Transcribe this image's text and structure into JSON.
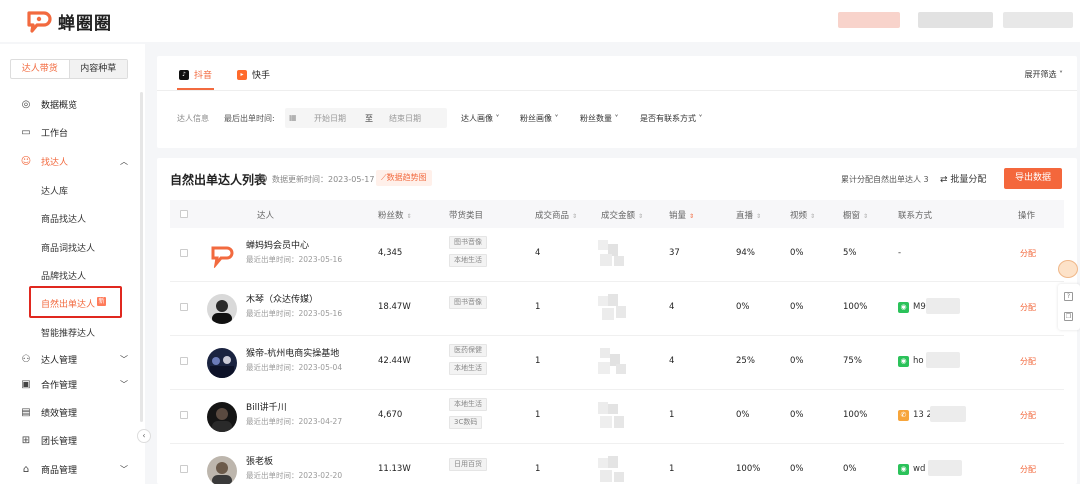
{
  "app": {
    "name": "蝉圈圈"
  },
  "sidebar": {
    "segment": {
      "active": "达人带货",
      "inactive": "内容种草"
    },
    "items": [
      {
        "label": "数据概览",
        "icon": "eye-icon"
      },
      {
        "label": "工作台",
        "icon": "monitor-icon"
      },
      {
        "label": "找达人",
        "icon": "user-search-icon",
        "expanded": true
      },
      {
        "label": "达人管理",
        "icon": "user-manage-icon"
      },
      {
        "label": "合作管理",
        "icon": "clipboard-icon"
      },
      {
        "label": "绩效管理",
        "icon": "chart-icon"
      },
      {
        "label": "团长管理",
        "icon": "group-icon"
      },
      {
        "label": "商品管理",
        "icon": "shop-icon"
      }
    ],
    "sub_items": [
      "达人库",
      "商品找达人",
      "商品词找达人",
      "品牌找达人",
      "自然出单达人",
      "智能推荐达人"
    ]
  },
  "filters": {
    "tabs": [
      {
        "label": "抖音",
        "icon": "douyin-icon",
        "color": "#111111"
      },
      {
        "label": "快手",
        "icon": "kuaishou-icon",
        "color": "#ff6a2c"
      }
    ],
    "expand_label": "展开筛选",
    "section_label": "达人信息",
    "last_order_label": "最后出单时间:",
    "start_date_placeholder": "开始日期",
    "date_sep": "至",
    "end_date_placeholder": "结束日期",
    "dropdowns": [
      "达人画像",
      "粉丝画像",
      "粉丝数量",
      "是否有联系方式"
    ]
  },
  "list": {
    "title": "自然出单达人列表",
    "update_time": "数据更新时间：2023-05-17",
    "heatmap_button": "数据趋势图",
    "assign_count_label": "累计分配自然出单达人 3",
    "batch_assign": "批量分配",
    "export_button": "导出数据",
    "columns": [
      "达人",
      "粉丝数",
      "带货类目",
      "成交商品",
      "成交金额",
      "销量",
      "直播",
      "视频",
      "橱窗",
      "联系方式",
      "操作"
    ],
    "rows": [
      {
        "name": "蝉妈妈会员中心",
        "last": "最近出单时间：2023-05-16",
        "fans": "4,345",
        "cats": [
          "图书音像",
          "本地生活"
        ],
        "products": "4",
        "sales": "37",
        "live": "94%",
        "video": "0%",
        "window": "5%",
        "contact_type": "",
        "contact": "-",
        "action": "分配"
      },
      {
        "name": "木琴（众达传媒）",
        "last": "最近出单时间：2023-05-16",
        "fans": "18.47W",
        "cats": [
          "图书音像"
        ],
        "products": "1",
        "sales": "4",
        "live": "0%",
        "video": "0%",
        "window": "100%",
        "contact_type": "wechat",
        "contact": "M9",
        "action": "分配"
      },
      {
        "name": "猴帝-杭州电商实操基地",
        "last": "最近出单时间：2023-05-04",
        "fans": "42.44W",
        "cats": [
          "医药保健",
          "本地生活"
        ],
        "products": "1",
        "sales": "4",
        "live": "25%",
        "video": "0%",
        "window": "75%",
        "contact_type": "wechat",
        "contact": "ho",
        "action": "分配"
      },
      {
        "name": "Bill讲千川",
        "last": "最近出单时间：2023-04-27",
        "fans": "4,670",
        "cats": [
          "本地生活",
          "3C数码"
        ],
        "products": "1",
        "sales": "1",
        "live": "0%",
        "video": "0%",
        "window": "100%",
        "contact_type": "phone",
        "contact": "13          2",
        "action": "分配"
      },
      {
        "name": "張老板",
        "last": "最近出单时间：2023-02-20",
        "fans": "11.13W",
        "cats": [
          "日用百货"
        ],
        "products": "1",
        "sales": "1",
        "live": "100%",
        "video": "0%",
        "window": "0%",
        "contact_type": "wechat",
        "contact": "wd",
        "action": "分配"
      }
    ]
  },
  "colors": {
    "accent": "#f26a3f",
    "export": "#f4673c",
    "highlight_box": "#e0281f",
    "wechat": "#2bc25a",
    "phone": "#f7a53b"
  }
}
